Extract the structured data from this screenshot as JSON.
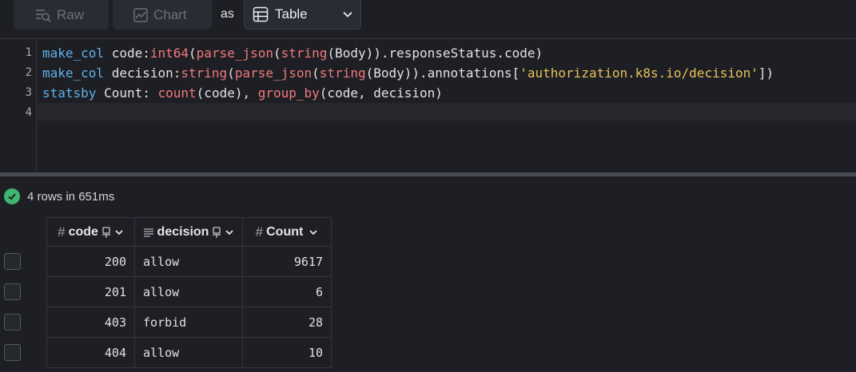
{
  "toolbar": {
    "raw_label": "Raw",
    "chart_label": "Chart",
    "as_label": "as",
    "view_select_value": "Table"
  },
  "editor": {
    "line_numbers": [
      "1",
      "2",
      "3",
      "4"
    ],
    "lines": [
      [
        {
          "t": "make_col",
          "c": "k"
        },
        {
          "t": " code:",
          "c": ""
        },
        {
          "t": "int64",
          "c": "f"
        },
        {
          "t": "(",
          "c": ""
        },
        {
          "t": "parse_json",
          "c": "f"
        },
        {
          "t": "(",
          "c": ""
        },
        {
          "t": "string",
          "c": "f"
        },
        {
          "t": "(Body)).responseStatus.code)",
          "c": ""
        }
      ],
      [
        {
          "t": "make_col",
          "c": "k"
        },
        {
          "t": " decision:",
          "c": ""
        },
        {
          "t": "string",
          "c": "f"
        },
        {
          "t": "(",
          "c": ""
        },
        {
          "t": "parse_json",
          "c": "f"
        },
        {
          "t": "(",
          "c": ""
        },
        {
          "t": "string",
          "c": "f"
        },
        {
          "t": "(Body)).annotations[",
          "c": ""
        },
        {
          "t": "'authorization.k8s.io/decision'",
          "c": "s"
        },
        {
          "t": "])",
          "c": ""
        }
      ],
      [
        {
          "t": "statsby",
          "c": "k"
        },
        {
          "t": " Count: ",
          "c": ""
        },
        {
          "t": "count",
          "c": "f"
        },
        {
          "t": "(code), ",
          "c": ""
        },
        {
          "t": "group_by",
          "c": "f"
        },
        {
          "t": "(code, decision)",
          "c": ""
        }
      ],
      []
    ]
  },
  "results": {
    "status_text": "4 rows in 651ms",
    "columns": [
      {
        "label": "code",
        "icon": "hash-icon"
      },
      {
        "label": "decision",
        "icon": "text-lines-icon"
      },
      {
        "label": "Count",
        "icon": "hash-icon"
      }
    ],
    "rows": [
      {
        "code": "200",
        "decision": "allow",
        "count": "9617"
      },
      {
        "code": "201",
        "decision": "allow",
        "count": "6"
      },
      {
        "code": "403",
        "decision": "forbid",
        "count": "28"
      },
      {
        "code": "404",
        "decision": "allow",
        "count": "10"
      }
    ]
  }
}
